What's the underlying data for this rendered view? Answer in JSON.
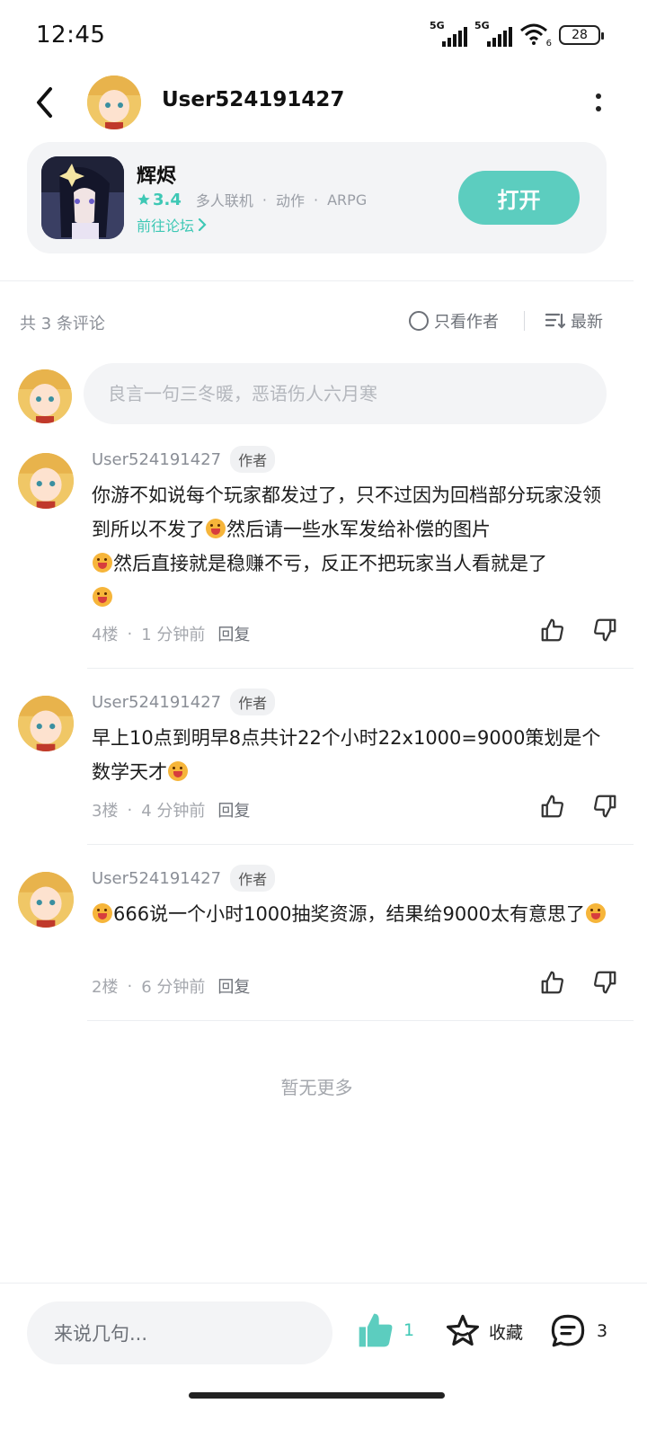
{
  "status_bar": {
    "time": "12:45",
    "battery": "28",
    "network_1": "5G",
    "network_2": "5G",
    "wifi_badge": "6"
  },
  "header": {
    "username": "User524191427"
  },
  "game": {
    "title": "辉烬",
    "rating": "3.4",
    "tags": [
      "多人联机",
      "动作",
      "ARPG"
    ],
    "forum_link": "前往论坛",
    "open_label": "打开"
  },
  "comments_bar": {
    "count_label": "共 3 条评论",
    "author_only_label": "只看作者",
    "sort_label": "最新"
  },
  "input": {
    "placeholder": "良言一句三冬暖，恶语伤人六月寒"
  },
  "comments": [
    {
      "user": "User524191427",
      "badge": "作者",
      "parts": [
        "你游不如说每个玩家都发过了，只不过因为回档部分玩家没领到所以不发了",
        "然后请一些水军发给补偿的图片",
        "然后直接就是稳赚不亏，反正不把玩家当人看就是了",
        ""
      ],
      "floor": "4楼",
      "time": "1 分钟前",
      "reply": "回复"
    },
    {
      "user": "User524191427",
      "badge": "作者",
      "parts": [
        "早上10点到明早8点共计22个小时22x1000=9000策划是个数学天才",
        ""
      ],
      "floor": "3楼",
      "time": "4 分钟前",
      "reply": "回复"
    },
    {
      "user": "User524191427",
      "badge": "作者",
      "parts": [
        "",
        "666说一个小时1000抽奖资源，结果给9000太有意思了",
        ""
      ],
      "floor": "2楼",
      "time": "6 分钟前",
      "reply": "回复"
    }
  ],
  "no_more": "暂无更多",
  "bottom_bar": {
    "reply_placeholder": "来说几句...",
    "like_count": "1",
    "favorite_label": "收藏",
    "comment_count": "3"
  },
  "colors": {
    "accent": "#5ccdbf",
    "accent_text": "#3ec8b5",
    "card_bg": "#f3f4f6"
  }
}
